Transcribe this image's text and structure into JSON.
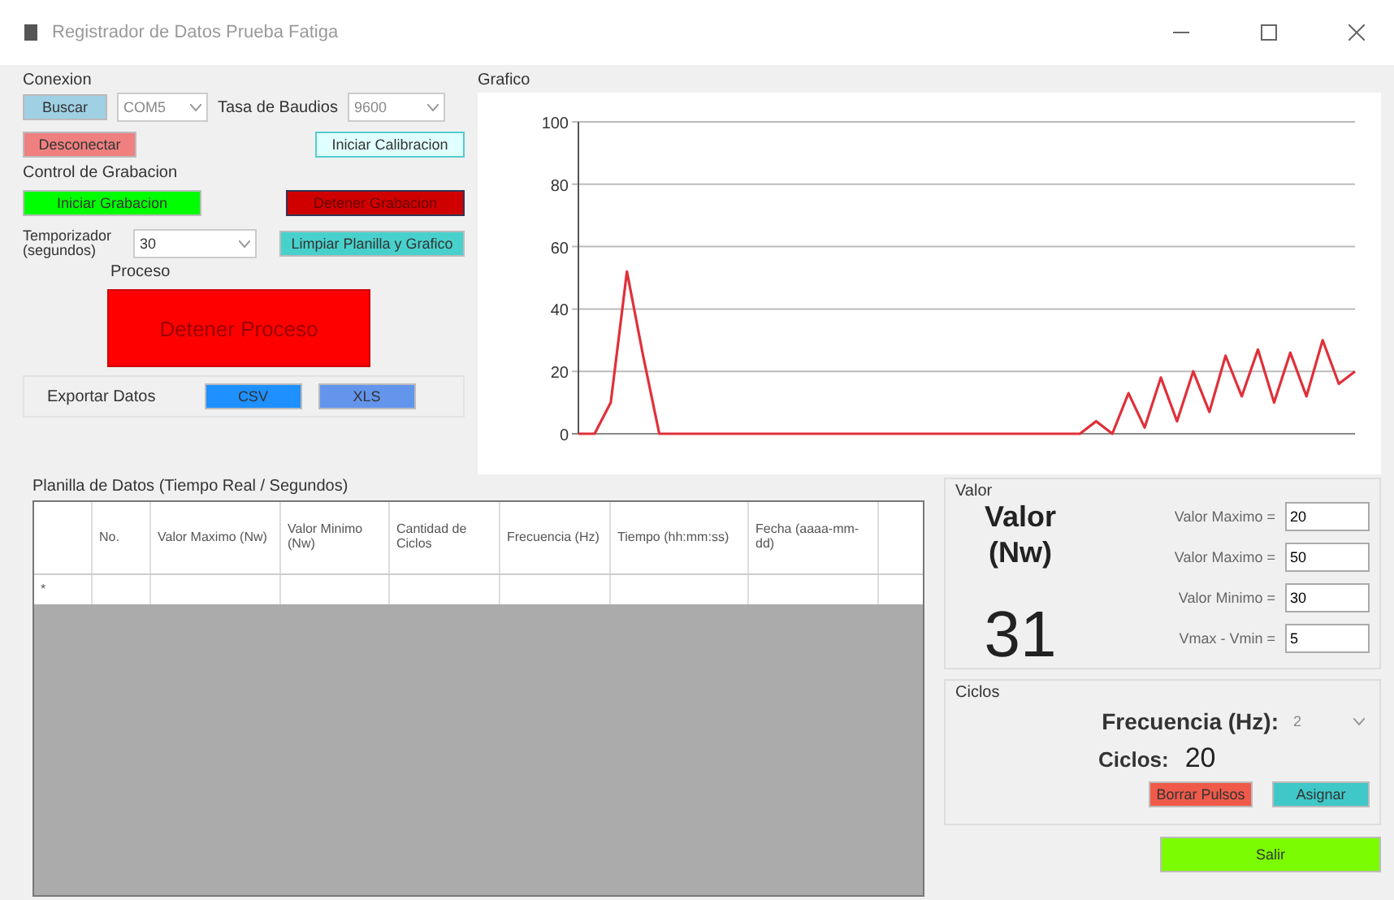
{
  "window": {
    "title": "Registrador de Datos Prueba Fatiga"
  },
  "conexion": {
    "title": "Conexion",
    "search_button": "Buscar",
    "port": "COM5",
    "baud_label": "Tasa de Baudios",
    "baud": "9600",
    "disconnect_button": "Desconectar",
    "calibrate_button": "Iniciar Calibracion"
  },
  "grabacion": {
    "title": "Control de Grabacion",
    "start_button": "Iniciar Grabacion",
    "stop_button": "Detener Grabacion",
    "timer_label": "Temporizador (segundos)",
    "timer": "30",
    "clear_button": "Limpiar Planilla y Grafico",
    "process_label": "Proceso",
    "process_button": "Detener Proceso"
  },
  "exportar": {
    "title": "Exportar Datos",
    "buttons": [
      "CSV",
      "XLS"
    ]
  },
  "grafico": {
    "title": "Grafico",
    "chart_data": {
      "type": "line",
      "grid": true,
      "ylim": [
        0,
        100
      ],
      "yticks": [
        0,
        20,
        40,
        60,
        80,
        100
      ],
      "categories": [
        null,
        null,
        null,
        null,
        null,
        null,
        null,
        null,
        null,
        null,
        null,
        null,
        null,
        null,
        null,
        null,
        null,
        null,
        null,
        null,
        null,
        null,
        null,
        null,
        null,
        null,
        null,
        null,
        null,
        null,
        null,
        null,
        null,
        null,
        null,
        null,
        null,
        null,
        null,
        null,
        null,
        null,
        null,
        null,
        null,
        null,
        null,
        null,
        null
      ],
      "values": [
        0,
        0,
        10,
        52,
        25,
        0,
        0,
        0,
        0,
        0,
        0,
        0,
        0,
        0,
        0,
        0,
        0,
        0,
        0,
        0,
        0,
        0,
        0,
        0,
        0,
        0,
        0,
        0,
        0,
        0,
        0,
        0,
        4,
        0,
        13,
        2,
        18,
        4,
        20,
        7,
        25,
        12,
        27,
        10,
        26,
        12,
        30,
        16,
        20
      ]
    }
  },
  "planilla": {
    "title": "Planilla de Datos (Tiempo Real / Segundos)",
    "columns": [
      "No.",
      "Valor Maximo (Nw)",
      "Valor Minimo (Nw)",
      "Cantidad de Ciclos",
      "Frecuencia (Hz)",
      "Tiempo (hh:mm:ss)",
      "Fecha (aaaa-mm-dd)"
    ],
    "new_row_marker": "*"
  },
  "valor": {
    "title": "Valor",
    "big_label": "Valor (Nw)",
    "reading": "31",
    "fields": [
      {
        "label": "Valor Maximo =",
        "value": "20"
      },
      {
        "label": "Valor Maximo =",
        "value": "50"
      },
      {
        "label": "Valor Minimo =",
        "value": "30"
      },
      {
        "label": "Vmax - Vmin =",
        "value": "5"
      }
    ]
  },
  "ciclos": {
    "title": "Ciclos",
    "freq_label": "Frecuencia (Hz):",
    "freq": "2",
    "cycles_label": "Ciclos:",
    "cycles": "20",
    "clear_button": "Borrar Pulsos",
    "assign_button": "Asignar"
  },
  "exit_button": "Salir"
}
